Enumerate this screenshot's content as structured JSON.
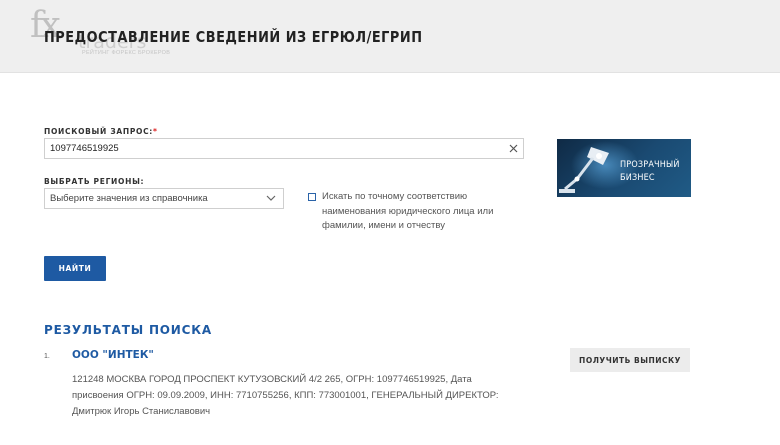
{
  "header": {
    "title": "ПРЕДОСТАВЛЕНИЕ СВЕДЕНИЙ ИЗ ЕГРЮЛ/ЕГРИП",
    "logo": {
      "fx": "fx",
      "traders": "traders",
      "tagline": "РЕЙТИНГ ФОРЕКС БРОКЕРОВ"
    }
  },
  "search": {
    "label": "ПОИСКОВЫЙ ЗАПРОС:",
    "required_mark": "*",
    "value": "1097746519925",
    "clear_icon": "close-icon"
  },
  "regions": {
    "label": "ВЫБРАТЬ РЕГИОНЫ:",
    "selected": "Выберите значения из справочника",
    "icon": "chevron-down-icon"
  },
  "exact_match": {
    "checked": false,
    "label": "Искать по точному соответствию наименования юридического лица или фамилии, имени и отчеству"
  },
  "find_button": "НАЙТИ",
  "banner": {
    "line1": "ПРОЗРАЧНЫЙ",
    "line2": "БИЗНЕС",
    "colors": {
      "bg": "#0f2a45",
      "accent": "#205b86"
    }
  },
  "results": {
    "title": "РЕЗУЛЬТАТЫ ПОИСКА",
    "items": [
      {
        "number": "1.",
        "name": "ООО \"ИНТЕК\"",
        "details": "121248 МОСКВА ГОРОД ПРОСПЕКТ КУТУЗОВСКИЙ 4/2 265, ОГРН: 1097746519925, Дата присвоения ОГРН: 09.09.2009, ИНН: 7710755256, КПП: 773001001, ГЕНЕРАЛЬНЫЙ ДИРЕКТОР: Дмитрюк Игорь Станиславович",
        "button": "ПОЛУЧИТЬ ВЫПИСКУ"
      }
    ]
  },
  "colors": {
    "primary": "#1e5aa3",
    "required": "#dd2222",
    "header_bg": "#efefef"
  }
}
